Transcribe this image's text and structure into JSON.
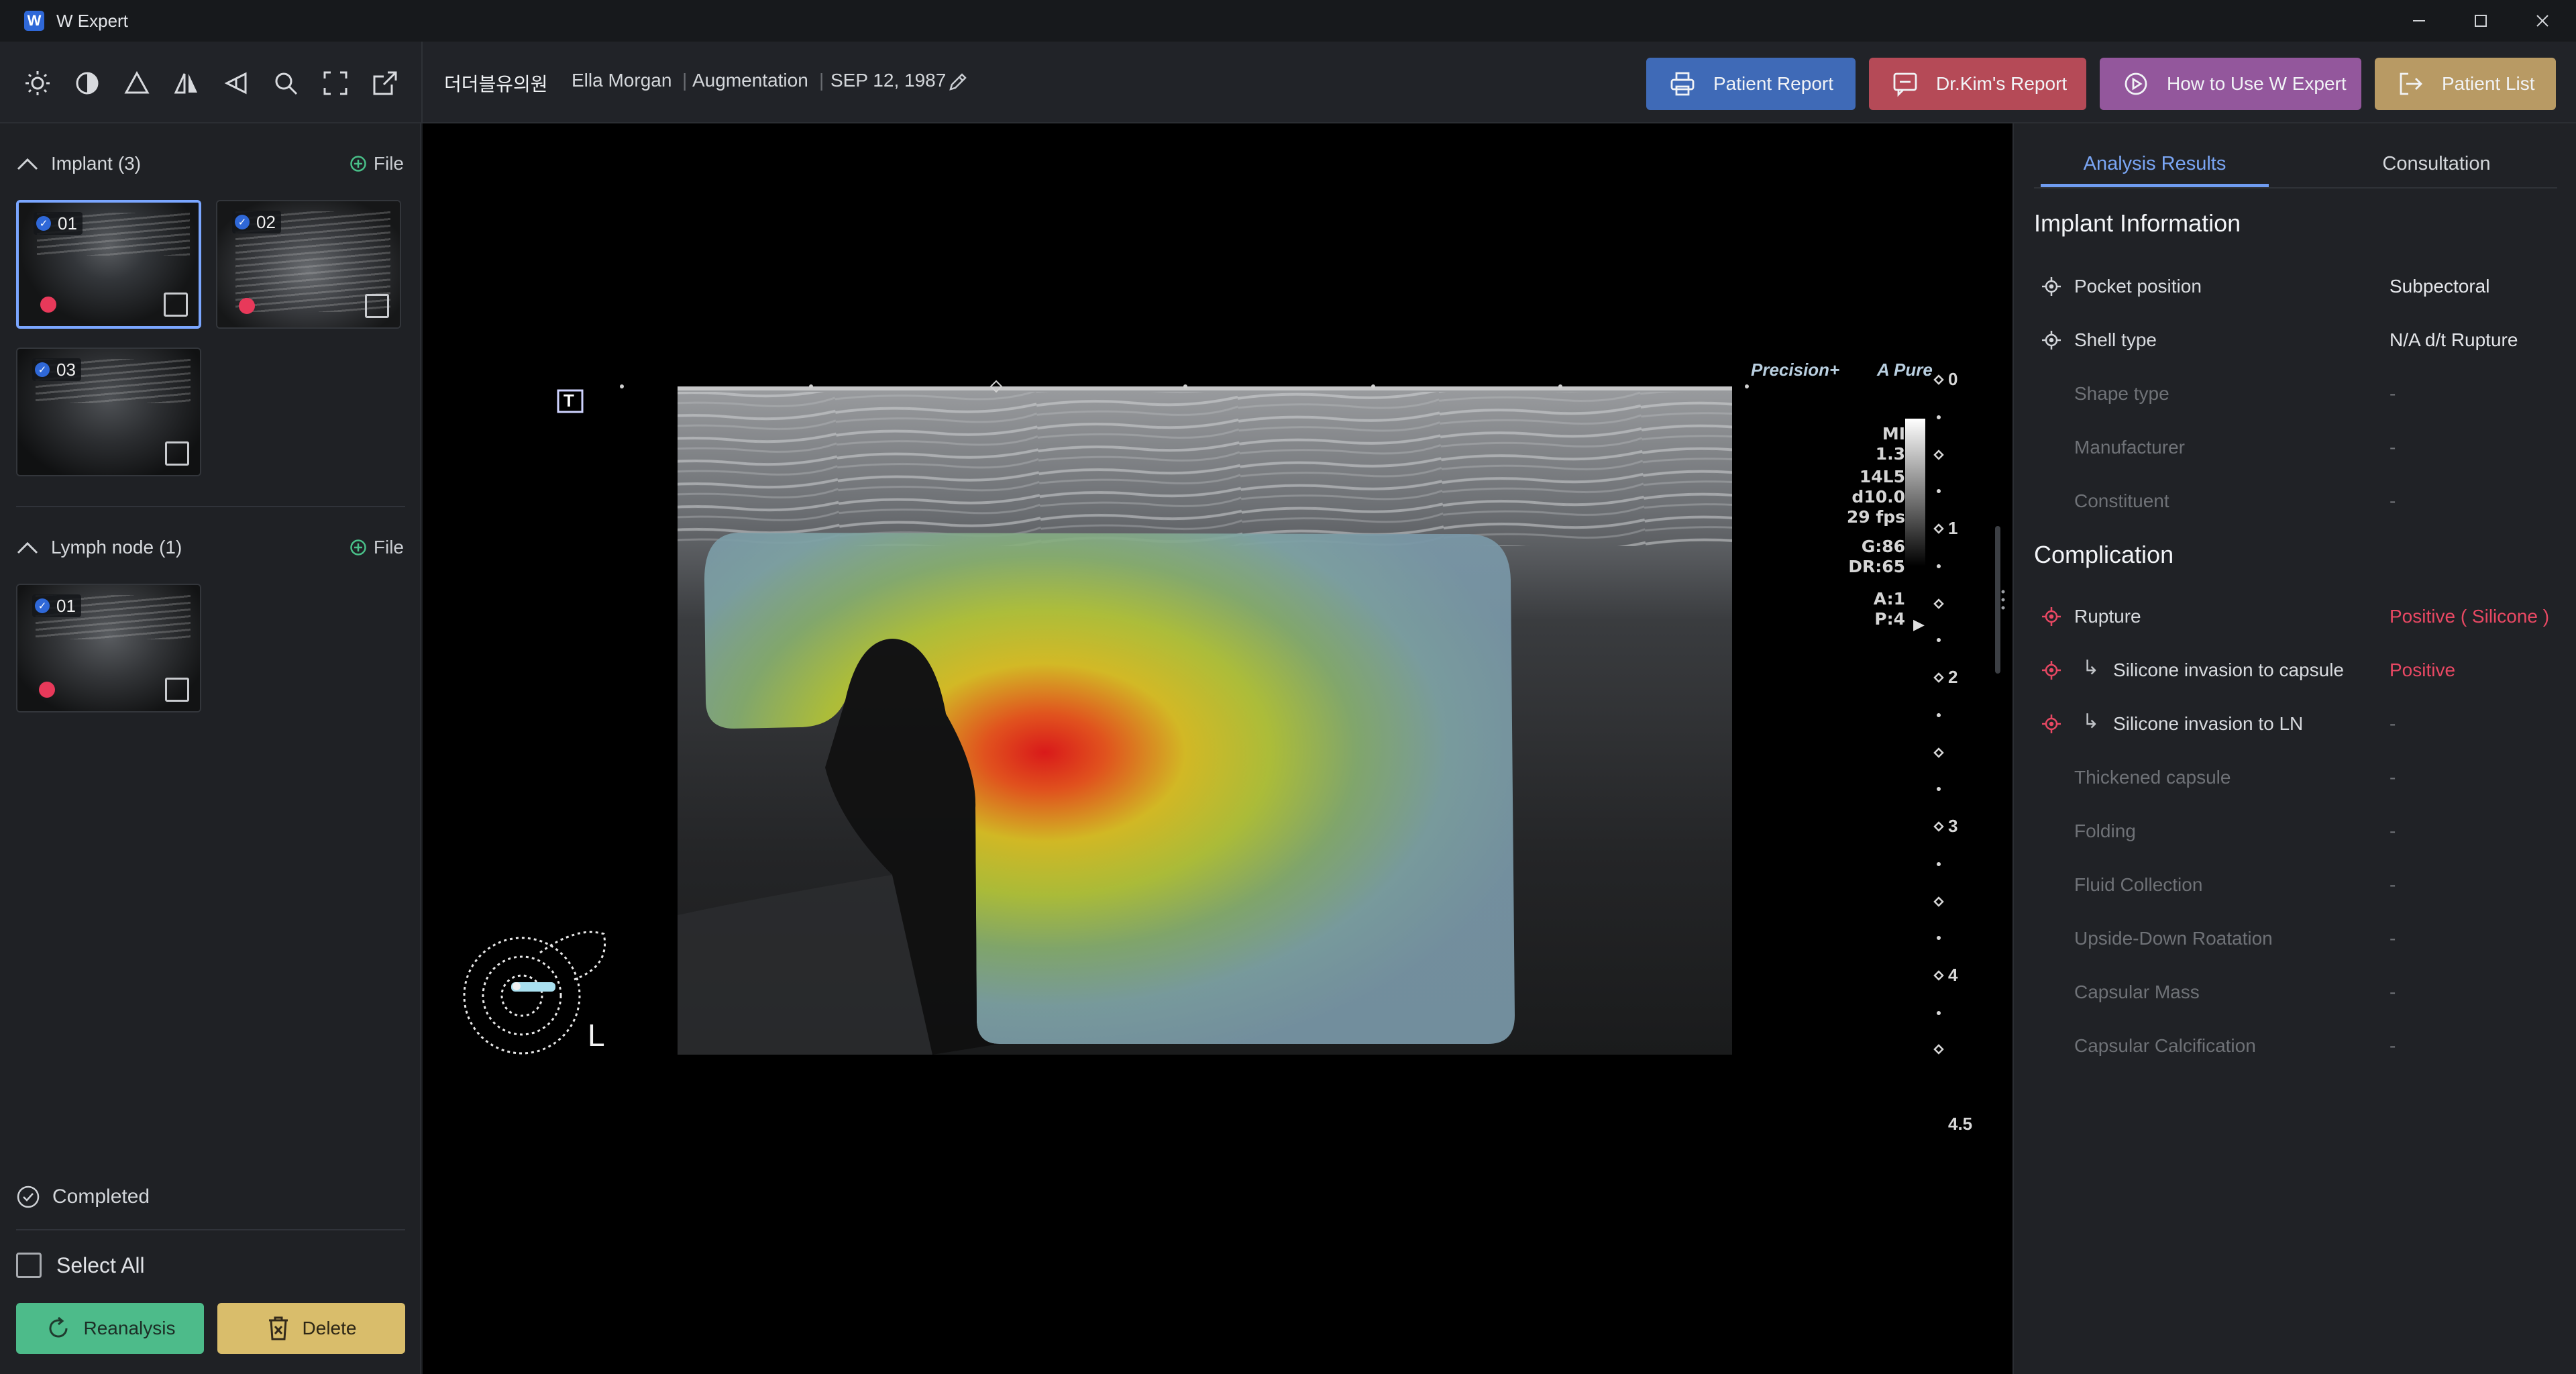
{
  "window": {
    "title": "W Expert",
    "logo_letter": "W",
    "controls": [
      "minimize-icon",
      "maximize-icon",
      "close-icon"
    ]
  },
  "toolbar": {
    "tools": [
      "brightness-icon",
      "contrast-icon",
      "triangle-icon",
      "flip-horizontal-icon",
      "flip-vertical-icon",
      "zoom-icon",
      "fullscreen-icon",
      "export-icon"
    ],
    "clinic": "더더블유의원",
    "patient_name": "Ella Morgan",
    "procedure": "Augmentation",
    "dob": "SEP 12, 1987",
    "buttons": {
      "patient_report": "Patient Report",
      "drkim_report": "Dr.Kim's Report",
      "how_to_use": "How to Use W Expert",
      "patient_list": "Patient List"
    },
    "button_colors": {
      "patient_report": "#3f6ab7",
      "drkim_report": "#b54a57",
      "how_to_use": "#93579c",
      "patient_list": "#b89a64"
    }
  },
  "left": {
    "implant_header": "Implant",
    "implant_count": "(3)",
    "file_label": "File",
    "implant_items": [
      {
        "label": "01",
        "flagged": true,
        "selected": true
      },
      {
        "label": "02",
        "flagged": true,
        "selected": false
      },
      {
        "label": "03",
        "flagged": false,
        "selected": false
      }
    ],
    "lymph_header": "Lymph node",
    "lymph_count": "(1)",
    "lymph_items": [
      {
        "label": "01",
        "flagged": true,
        "selected": false
      }
    ],
    "completed": "Completed",
    "select_all": "Select All",
    "reanalysis": "Reanalysis",
    "delete": "Delete"
  },
  "viewer": {
    "brand_precision": "Precision+",
    "brand_apure": "A Pure",
    "params": [
      "MI",
      "1.3",
      "14L5",
      "d10.0",
      "29 fps",
      "G:86",
      "DR:65",
      "A:1",
      "P:4"
    ],
    "depth_scale": [
      "0",
      "1",
      "2",
      "3",
      "4",
      "4.5"
    ],
    "side_marker": "L",
    "t_marker": "T"
  },
  "right": {
    "tabs": [
      "Analysis Results",
      "Consultation"
    ],
    "active_tab": "Analysis Results",
    "implant_info_title": "Implant Information",
    "implant_info": [
      {
        "label": "Pocket position",
        "value": "Subpectoral",
        "icon": true
      },
      {
        "label": "Shell type",
        "value": "N/A d/t Rupture",
        "icon": true
      },
      {
        "label": "Shape type",
        "value": "-",
        "icon": false
      },
      {
        "label": "Manufacturer",
        "value": "-",
        "icon": false
      },
      {
        "label": "Constituent",
        "value": "-",
        "icon": false
      }
    ],
    "complication_title": "Complication",
    "complications": [
      {
        "label": "Rupture",
        "value": "Positive ( Silicone )",
        "icon": true,
        "sub": false
      },
      {
        "label": "Silicone invasion to capsule",
        "value": "Positive",
        "icon": true,
        "sub": true
      },
      {
        "label": "Silicone invasion to LN",
        "value": "-",
        "icon": true,
        "sub": true
      },
      {
        "label": "Thickened capsule",
        "value": "-",
        "icon": false,
        "sub": false
      },
      {
        "label": "Folding",
        "value": "-",
        "icon": false,
        "sub": false
      },
      {
        "label": "Fluid Collection",
        "value": "-",
        "icon": false,
        "sub": false
      },
      {
        "label": "Upside-Down Roatation",
        "value": "-",
        "icon": false,
        "sub": false
      },
      {
        "label": "Capsular Mass",
        "value": "-",
        "icon": false,
        "sub": false
      },
      {
        "label": "Capsular Calcification",
        "value": "-",
        "icon": false,
        "sub": false
      }
    ],
    "positive_color": "#e84863"
  }
}
